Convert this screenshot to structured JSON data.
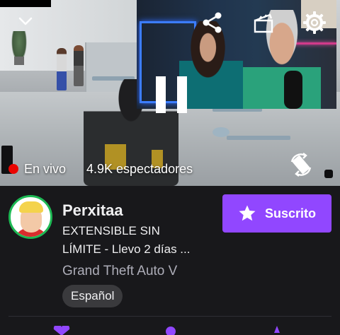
{
  "player": {
    "live_label": "En vivo",
    "viewers": "4.9K espectadores",
    "icons": {
      "collapse": "chevron-down-icon",
      "share": "share-icon",
      "clip": "clip-icon",
      "settings": "gear-icon",
      "pause": "pause-icon",
      "rotate": "rotate-screen-icon"
    },
    "colors": {
      "live_dot": "#eb0400"
    }
  },
  "channel": {
    "name": "Perxitaa",
    "title_line1": "EXTENSIBLE SIN",
    "title_line2": "LÍMITE - Llevo 2 días ...",
    "game": "Grand Theft Auto V",
    "tag": "Español",
    "avatar_ring_color": "#1db954"
  },
  "subscribe": {
    "label": "Suscrito",
    "icon": "star-icon",
    "color": "#9147ff"
  }
}
